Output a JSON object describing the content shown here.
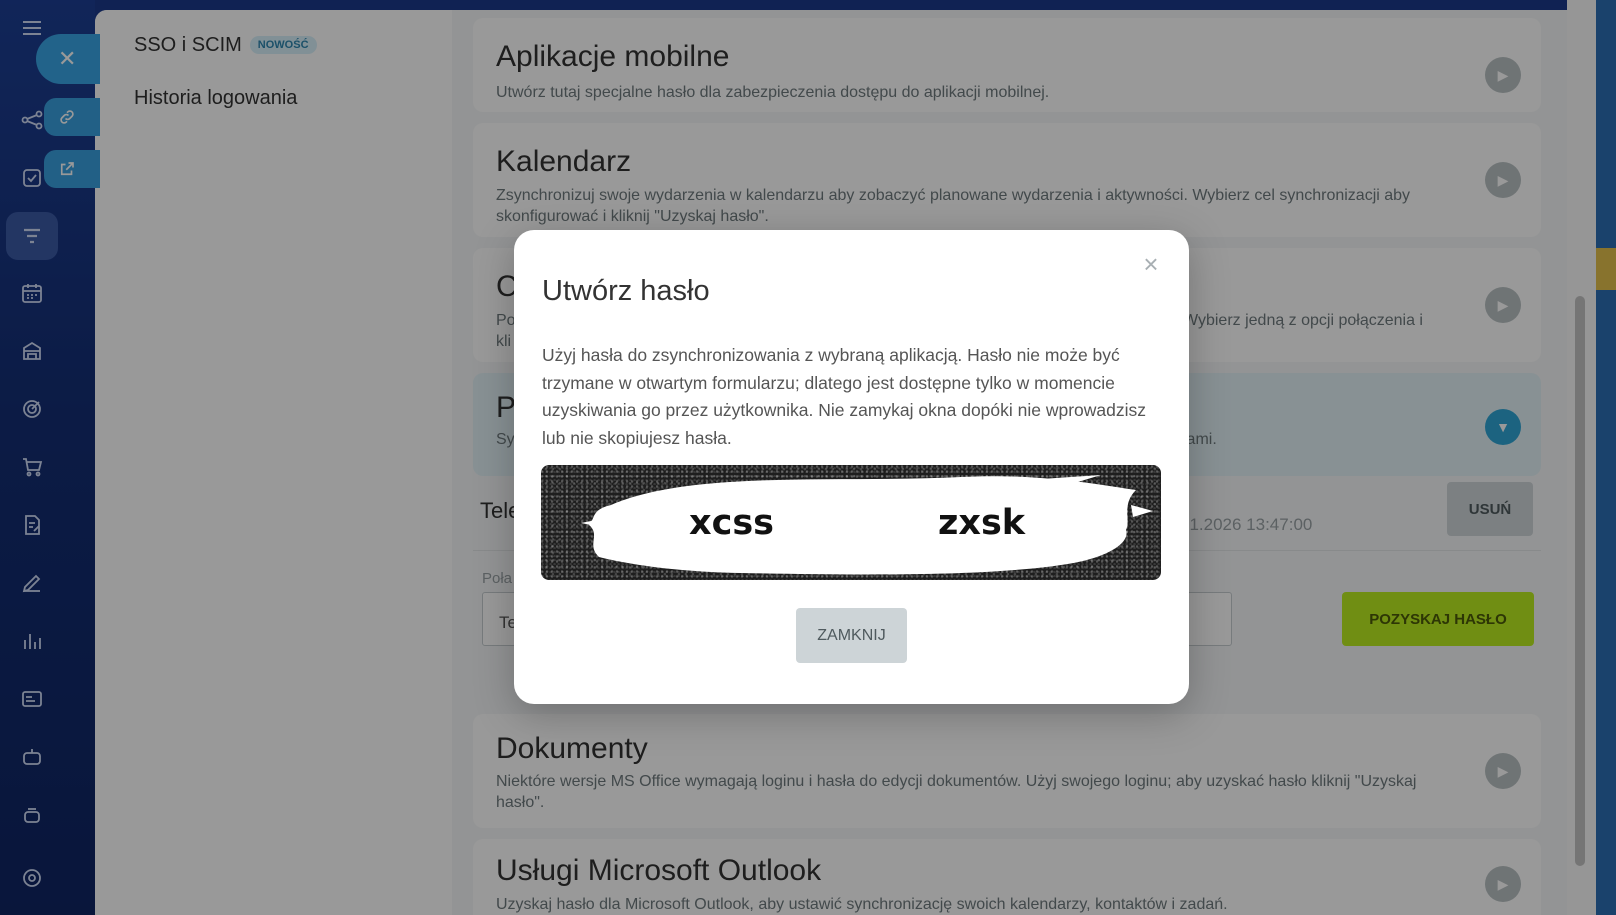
{
  "sidebar": {
    "icons": [
      "menu-icon",
      "flow-icon",
      "tasks-icon",
      "filter-icon",
      "calendar-icon",
      "store-icon",
      "target-icon",
      "cart-icon",
      "sign-doc-icon",
      "pen-icon",
      "chart-icon",
      "card-icon",
      "robot-icon",
      "settings-icon"
    ]
  },
  "subnav": {
    "items": [
      {
        "label": "SSO i SCIM",
        "badge": "NOWOŚĆ"
      },
      {
        "label": "Historia logowania"
      }
    ]
  },
  "cards": [
    {
      "title": "Aplikacje mobilne",
      "description": "Utwórz tutaj specjalne hasło dla zabezpieczenia dostępu do aplikacji mobilnej."
    },
    {
      "title": "Kalendarz",
      "description": "Zsynchronizuj swoje wydarzenia w kalendarzu aby zobaczyć planowane wydarzenia i aktywności. Wybierz cel synchronizacji aby skonfigurować i kliknij \"Uzyskaj hasło\"."
    },
    {
      "title": "C",
      "description_left": "Po",
      "description_left2": "kli",
      "description_right": "Wybierz jedną z opcji połączenia i"
    },
    {
      "title": "P",
      "description_left": "Sy",
      "description_right": "jami."
    },
    {
      "title": "Dokumenty",
      "description": "Niektóre wersje MS Office wymagają loginu i hasła do edycji dokumentów. Użyj swojego loginu; aby uzyskać hasło kliknij \"Uzyskaj hasło\"."
    },
    {
      "title": "Usługi Microsoft Outlook",
      "description": "Uzyskaj hasło dla Microsoft Outlook, aby ustawić synchronizację swoich kalendarzy, kontaktów i zadań."
    }
  ],
  "password_row": {
    "title_partial": "Tele",
    "date_partial": "01.2026 13:47:00",
    "delete_label": "USUŃ"
  },
  "new_password": {
    "label_partial": "Poła",
    "input_partial": "Te",
    "button_label": "POZYSKAJ HASŁO"
  },
  "modal": {
    "title": "Utwórz hasło",
    "text": "Użyj hasła do zsynchronizowania z wybraną aplikacją. Hasło nie może być trzymane w otwartym formularzu; dlatego jest dostępne tylko w momencie uzyskiwania go przez użytkownika. Nie zamykaj okna dopóki nie wprowadzisz lub nie skopiujesz hasła.",
    "password_part1": "xcss",
    "password_part2": "zxsk",
    "close_label": "ZAMKNIJ"
  },
  "colors": {
    "rail": "#1d3f94",
    "accent_blue": "#2fa6d6",
    "green_button": "#bbed21"
  }
}
